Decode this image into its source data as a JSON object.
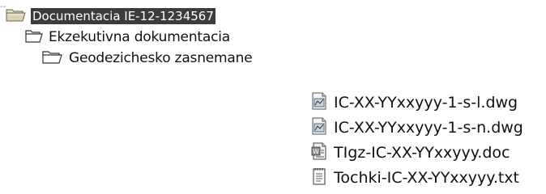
{
  "tree": {
    "root": {
      "label": "Documentacia IE-12-1234567",
      "icon": "open-folder-icon"
    },
    "child": {
      "label": "Ekzekutivna dokumentacia",
      "icon": "open-folder-icon"
    },
    "grandchild": {
      "label": "Geodezichesko zasnemane",
      "icon": "open-folder-icon"
    }
  },
  "files": [
    {
      "label": "IC-XX-YYxxyyy-1-s-l.dwg",
      "icon": "dwg-file-icon"
    },
    {
      "label": "IC-XX-YYxxyyy-1-s-n.dwg",
      "icon": "dwg-file-icon"
    },
    {
      "label": "TIgz-IC-XX-YYxxyyy.doc",
      "icon": "doc-file-icon"
    },
    {
      "label": "Tochki-IC-XX-YYxxyyy.txt",
      "icon": "txt-file-icon"
    }
  ]
}
